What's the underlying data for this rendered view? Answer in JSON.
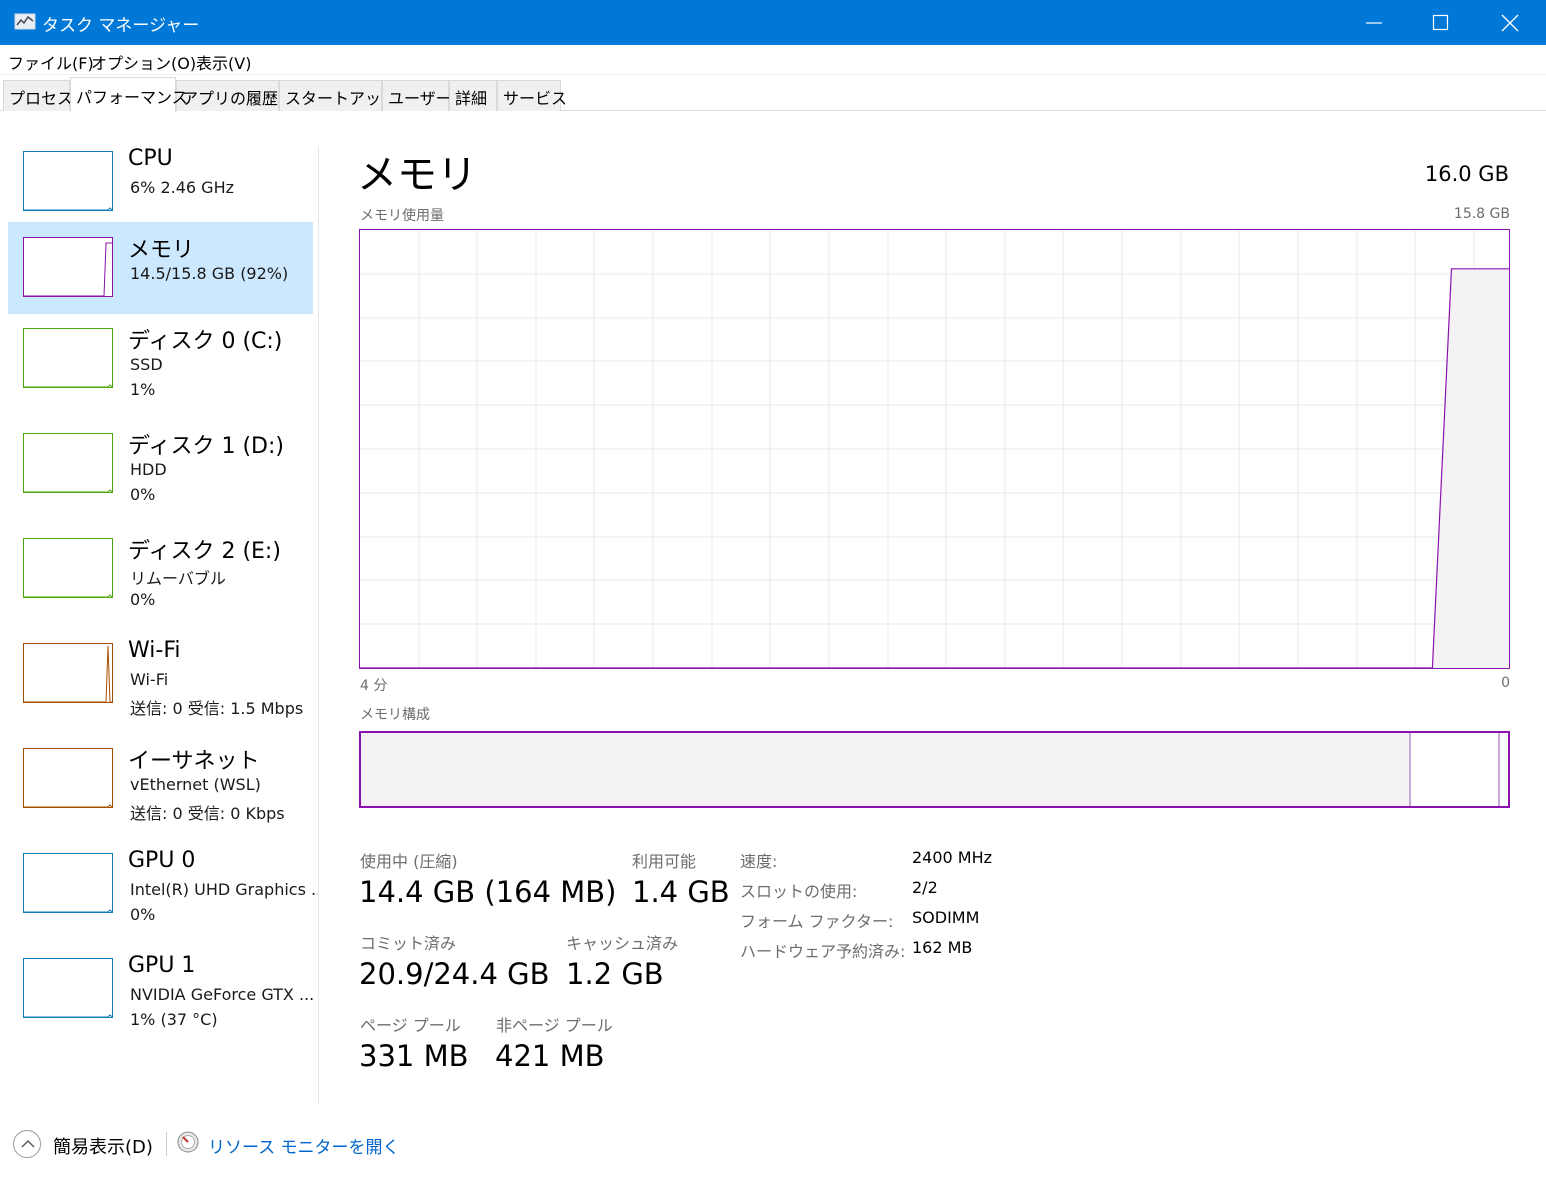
{
  "window": {
    "title": "タスク マネージャー"
  },
  "menu": {
    "items": [
      "ファイル(F)",
      "オプション(O)",
      "表示(V)"
    ]
  },
  "tabs": [
    "プロセス",
    "パフォーマンス",
    "アプリの履歴",
    "スタートアップ",
    "ユーザー",
    "詳細",
    "サービス"
  ],
  "active_tab": "パフォーマンス",
  "sidebar": {
    "items": [
      {
        "name": "CPU",
        "line1": "6%  2.46 GHz",
        "line2": "",
        "color": "#117dbb",
        "selected": false
      },
      {
        "name": "メモリ",
        "line1": "14.5/15.8 GB (92%)",
        "line2": "",
        "color": "#8b12ae",
        "selected": true
      },
      {
        "name": "ディスク 0 (C:)",
        "line1": "SSD",
        "line2": "1%",
        "color": "#4da60c",
        "selected": false
      },
      {
        "name": "ディスク 1 (D:)",
        "line1": "HDD",
        "line2": "0%",
        "color": "#4da60c",
        "selected": false
      },
      {
        "name": "ディスク 2 (E:)",
        "line1": "リムーバブル",
        "line2": "0%",
        "color": "#4da60c",
        "selected": false
      },
      {
        "name": "Wi-Fi",
        "line1": "Wi-Fi",
        "line2": "送信: 0  受信: 1.5 Mbps",
        "color": "#a74f01",
        "selected": false
      },
      {
        "name": "イーサネット",
        "line1": "vEthernet (WSL)",
        "line2": "送信: 0  受信: 0 Kbps",
        "color": "#a74f01",
        "selected": false
      },
      {
        "name": "GPU 0",
        "line1": "Intel(R) UHD Graphics ...",
        "line2": "0%",
        "color": "#117dbb",
        "selected": false
      },
      {
        "name": "GPU 1",
        "line1": "NVIDIA GeForce GTX ...",
        "line2": "1% (37 °C)",
        "color": "#117dbb",
        "selected": false
      }
    ]
  },
  "main": {
    "title": "メモリ",
    "total": "16.0 GB",
    "usage_label": "メモリ使用量",
    "usage_max": "15.8 GB",
    "axis_left": "4 分",
    "axis_right": "0",
    "composition_label": "メモリ構成",
    "composition_used_fraction": 0.915,
    "stats": {
      "in_use_label": "使用中 (圧縮)",
      "in_use_value": "14.4 GB (164 MB)",
      "available_label": "利用可能",
      "available_value": "1.4 GB",
      "committed_label": "コミット済み",
      "committed_value": "20.9/24.4 GB",
      "cached_label": "キャッシュ済み",
      "cached_value": "1.2 GB",
      "paged_label": "ページ プール",
      "paged_value": "331 MB",
      "nonpaged_label": "非ページ プール",
      "nonpaged_value": "421 MB"
    },
    "specs": [
      {
        "label": "速度:",
        "value": "2400 MHz"
      },
      {
        "label": "スロットの使用:",
        "value": "2/2"
      },
      {
        "label": "フォーム ファクター:",
        "value": "SODIMM"
      },
      {
        "label": "ハードウェア予約済み:",
        "value": "162 MB"
      }
    ]
  },
  "chart_data": {
    "type": "area",
    "title": "メモリ使用量",
    "xlabel": "",
    "ylabel": "",
    "x_range_label": [
      "4 分",
      "0"
    ],
    "ylim": [
      0,
      15.8
    ],
    "series": [
      {
        "values": [
          0,
          0,
          0,
          0,
          0,
          0,
          0,
          0,
          0,
          0,
          0,
          0,
          0,
          0,
          0,
          0,
          0,
          0,
          0,
          0,
          0,
          0,
          0,
          0,
          0,
          0,
          0,
          0,
          0,
          0,
          0,
          0,
          0,
          0,
          0,
          0,
          0,
          0,
          0,
          0,
          0,
          0,
          0,
          0,
          0,
          0,
          0,
          0,
          0,
          0,
          0,
          0,
          0,
          0,
          0,
          0,
          0,
          14.4,
          14.4,
          14.4,
          14.4
        ]
      }
    ],
    "grid": true,
    "color": "#8b12ae"
  },
  "footer": {
    "fewer_details": "簡易表示(D)",
    "open_resmon": "リソース モニターを開く"
  }
}
